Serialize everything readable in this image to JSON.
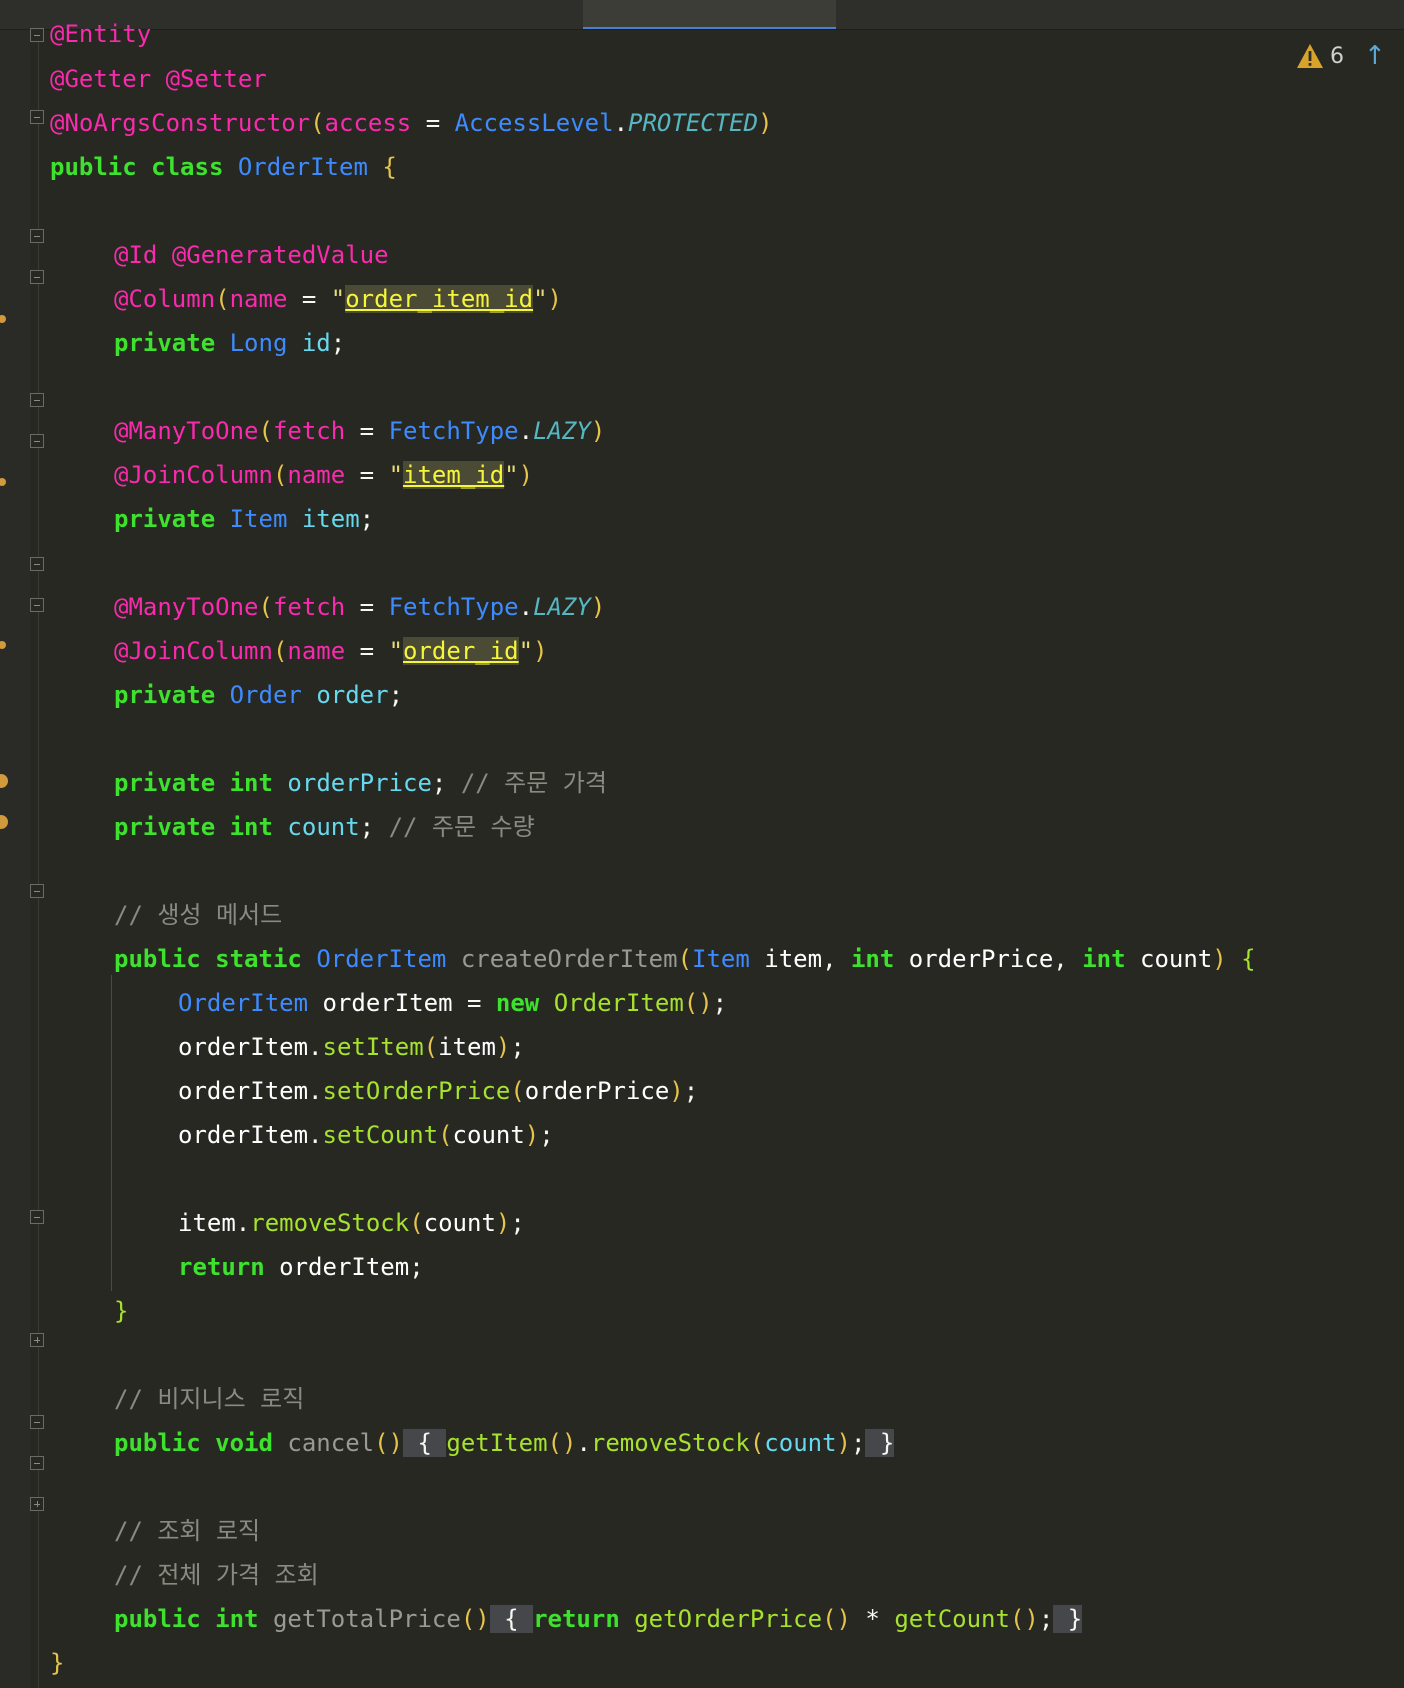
{
  "editor": {
    "inspections": {
      "warning_count": "6",
      "warning_icon": "warning-triangle-icon",
      "next_icon": "arrow-up-icon"
    },
    "code": {
      "entity": "@Entity",
      "getter": "@Getter",
      "setter": "@Setter",
      "noargs": "@NoArgsConstructor",
      "access": "access",
      "accesslevel": "AccessLevel",
      "protected": "PROTECTED",
      "public": "public",
      "class": "class",
      "classname": "OrderItem",
      "id_ann": "@Id",
      "genval": "@GeneratedValue",
      "column": "@Column",
      "name": "name",
      "order_item_id": "order_item_id",
      "private": "private",
      "long": "Long",
      "id": "id",
      "manytoone": "@ManyToOne",
      "fetch": "fetch",
      "fetchtype": "FetchType",
      "lazy": "LAZY",
      "joincolumn": "@JoinColumn",
      "item_id": "item_id",
      "item_type": "Item",
      "item_var": "item",
      "order_id": "order_id",
      "order_type": "Order",
      "order_var": "order",
      "int": "int",
      "orderPrice": "orderPrice",
      "comment_price": "// 주문 가격",
      "count": "count",
      "comment_count": "// 주문 수량",
      "comment_create": "// 생성 메서드",
      "static": "static",
      "createOrderItem": "createOrderItem",
      "orderItem_var": "orderItem",
      "new": "new",
      "ctor": "OrderItem",
      "setItem": "setItem",
      "setOrderPrice": "setOrderPrice",
      "setCount": "setCount",
      "removeStock": "removeStock",
      "return": "return",
      "comment_business": "// 비지니스 로직",
      "void": "void",
      "cancel": "cancel",
      "getItem": "getItem",
      "comment_query": "// 조회 로직",
      "comment_total": "// 전체 가격 조회",
      "getTotalPrice": "getTotalPrice",
      "getOrderPrice": "getOrderPrice",
      "getCount": "getCount"
    }
  }
}
